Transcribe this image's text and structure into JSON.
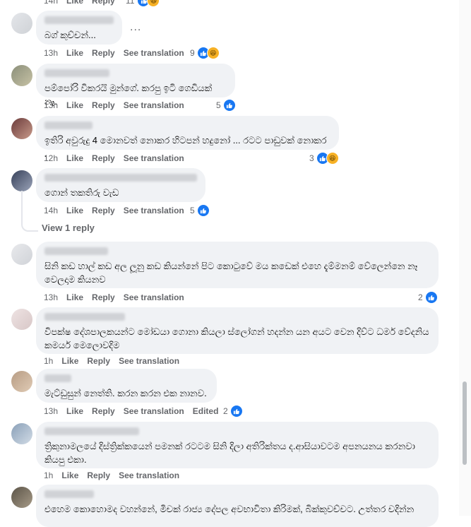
{
  "colors": {
    "accent": "#1877f2",
    "bubble": "#f0f2f5",
    "meta": "#65676b"
  },
  "top": {
    "time": "14h",
    "like": "Like",
    "reply": "Reply",
    "count": "11"
  },
  "comments": [
    {
      "text": "බග් කුච්චන්...",
      "time": "13h",
      "like": "Like",
      "reply": "Reply",
      "translate": "See translation",
      "reactions": "9",
      "icons": [
        "like-icon",
        "haha-icon"
      ],
      "more": "..."
    },
    {
      "text": "පම්පෝරි විකරයි මුන්ගේ. කරපු ඉටි ගෙඩියක් නෑ.",
      "time": "13h",
      "like": "Like",
      "reply": "Reply",
      "translate": "See translation",
      "reactions": "5",
      "icons": [
        "like-icon"
      ]
    },
    {
      "text": "ඉතිරි අවුරුදු 4 මොනවත් නොකර හිටපන් හදුනෝ ... රටට පාඩුවක් නොකර .",
      "time": "12h",
      "like": "Like",
      "reply": "Reply",
      "translate": "See translation",
      "reactions": "3",
      "icons": [
        "like-icon",
        "haha-icon"
      ]
    },
    {
      "text": "ගොන් තකතිරු වැඩ",
      "time": "14h",
      "like": "Like",
      "reply": "Reply",
      "translate": "See translation",
      "reactions": "5",
      "icons": [
        "like-icon"
      ],
      "view_reply": "View 1 reply"
    },
    {
      "text": "සිනි කඩ හාල් කඩ අල ලූනු කඩ කියන්නේ පිට කොටුවේ මය කඩෙක් එහෙ දැම්මනම් වේලෙන්නෙ නෑ වෙලදාම කියනව",
      "time": "13h",
      "like": "Like",
      "reply": "Reply",
      "translate": "See translation",
      "reactions": "2",
      "icons": [
        "like-icon"
      ]
    },
    {
      "text": "විපක්ෂ දේශපාලකයන්ට මෝඩයා ගොනා කියලා ස්ලෝගන් හදන්න යන අයට වෙන දිව්ට ධමර් වේදනිය කමර්ය මෙලොවදිම",
      "time": "1h",
      "like": "Like",
      "reply": "Reply",
      "translate": "See translation"
    },
    {
      "text": "මැට්ඩුසුන් නෙත්ති. කරන කරන එක නානව.",
      "time": "13h",
      "like": "Like",
      "reply": "Reply",
      "translate": "See translation",
      "edited": "Edited",
      "reactions": "2",
      "icons": [
        "like-icon"
      ]
    },
    {
      "text": "ත්‍රිකුනාමලයේ දිස්ත්‍රික්කයෙන් පමනක් රටටම සිනි දිලා අතිරික්තය ද.ආසියාවටම අපනයනය කරනවා කියපු එකා.",
      "time": "1h",
      "like": "Like",
      "reply": "Reply",
      "translate": "See translation"
    },
    {
      "text": "එහෙම කොහොමද වහන්නේ, මිචක් රාජ්‍ය දේපල අවභාවිතා කිරිමක්, බික්කුවච්චට. උත්තර චදින්න"
    }
  ]
}
